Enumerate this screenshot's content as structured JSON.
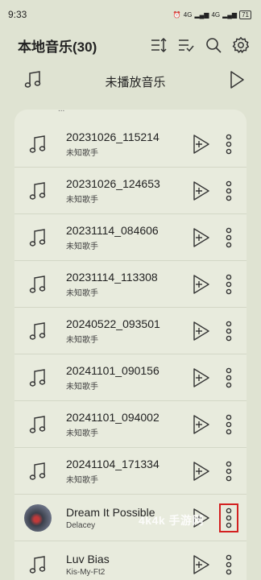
{
  "status": {
    "time": "9:33",
    "signal1": "4G",
    "signal2": "4G",
    "battery": "71"
  },
  "header": {
    "title": "本地音乐(30)"
  },
  "icons": {
    "sort": "sort-icon",
    "multiselect": "multi-select-icon",
    "search": "search-icon",
    "settings": "gear-icon"
  },
  "unplayed": {
    "label": "未播放音乐"
  },
  "list": {
    "clipped_hint": "...",
    "rows": [
      {
        "title": "20231026_115214",
        "artist": "未知歌手"
      },
      {
        "title": "20231026_124653",
        "artist": "未知歌手"
      },
      {
        "title": "20231114_084606",
        "artist": "未知歌手"
      },
      {
        "title": "20231114_113308",
        "artist": "未知歌手"
      },
      {
        "title": "20240522_093501",
        "artist": "未知歌手"
      },
      {
        "title": "20241101_090156",
        "artist": "未知歌手"
      },
      {
        "title": "20241101_094002",
        "artist": "未知歌手"
      },
      {
        "title": "20241104_171334",
        "artist": "未知歌手"
      },
      {
        "title": "Dream It Possible",
        "artist": "Delacey"
      },
      {
        "title": "Luv Bias",
        "artist": "Kis-My-Ft2"
      }
    ]
  },
  "watermark": "4k4k 手游网",
  "colors": {
    "background": "#dfe3d2",
    "panel": "#e8ebdd",
    "highlight": "#d32020"
  }
}
